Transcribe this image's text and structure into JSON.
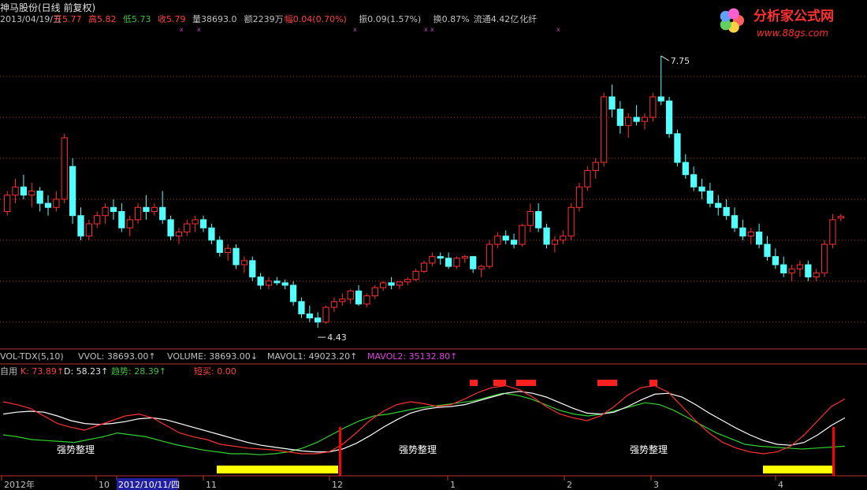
{
  "header": {
    "title": "神马股份(日线 前复权)",
    "date": "2013/04/19/五",
    "fields": [
      {
        "label": "开",
        "value": "5.77",
        "color": "#ff4040"
      },
      {
        "label": "高",
        "value": "5.82",
        "color": "#ff4040"
      },
      {
        "label": "低",
        "value": "5.73",
        "color": "#40c040"
      },
      {
        "label": "收",
        "value": "5.79",
        "color": "#ff4040"
      },
      {
        "label": "量",
        "value": "38693.0",
        "color": "#c0c0c0"
      },
      {
        "label": "额",
        "value": "2239万",
        "color": "#c0c0c0"
      },
      {
        "label": "幅",
        "value": "0.04(0.70%)",
        "color": "#ff4040"
      },
      {
        "label": "振",
        "value": "0.09(1.57%)",
        "color": "#c0c0c0"
      },
      {
        "label": "换",
        "value": "0.87%",
        "color": "#c0c0c0"
      },
      {
        "label": "流通",
        "value": "4.42亿",
        "color": "#c0c0c0"
      },
      {
        "label": "",
        "value": "化纤",
        "color": "#c0c0c0"
      }
    ]
  },
  "logo": {
    "name": "分析家公式网",
    "url": "www.88gs.com"
  },
  "volume_bar": {
    "items": [
      {
        "text": "VOL-TDX(5,10)",
        "color": "#c0c0c0"
      },
      {
        "text": "VVOL: 38693.00↑",
        "color": "#c0c0c0"
      },
      {
        "text": "VOLUME: 38693.00↓",
        "color": "#c0c0c0"
      },
      {
        "text": "MAVOL1: 49023.20↑",
        "color": "#c0c0c0"
      },
      {
        "text": "MAVOL2: 35132.80↑",
        "color": "#e040e0"
      }
    ]
  },
  "indicator_bar": {
    "items": [
      {
        "text": "自用",
        "color": "#c0c0c0"
      },
      {
        "text": "K: 73.89↑",
        "color": "#ff4040"
      },
      {
        "text": "D: 58.23↑",
        "color": "#e0e0e0"
      },
      {
        "text": "趋势: 28.39↑",
        "color": "#40c040"
      },
      {
        "text": "短买: 0.00",
        "color": "#ff4040"
      }
    ]
  },
  "annotations": {
    "high": "7.75",
    "low": "4.43",
    "zone_label": "强势整理"
  },
  "colors": {
    "up": "#ff3030",
    "down": "#54ffff",
    "k": "#ff3030",
    "d": "#ffffff",
    "trend": "#30d030",
    "zone": "#ffff00",
    "signal": "#ff0000",
    "axis": "#c03030"
  },
  "chart_data": {
    "type": "candlestick",
    "title": "神马股份(日线 前复权)",
    "price_range": [
      4.2,
      8.0
    ],
    "x_axis_labels": [
      "2012年",
      "10",
      "2012/10/11/四",
      "11",
      "12",
      "1",
      "2",
      "3",
      "4"
    ],
    "ohlc_estimated_daily": [
      [
        5.85,
        6.1,
        5.8,
        6.05
      ],
      [
        6.05,
        6.25,
        5.95,
        6.15
      ],
      [
        6.15,
        6.3,
        6.0,
        6.05
      ],
      [
        6.05,
        6.2,
        5.9,
        6.1
      ],
      [
        6.1,
        6.15,
        5.85,
        5.95
      ],
      [
        5.95,
        6.05,
        5.8,
        5.9
      ],
      [
        5.9,
        6.1,
        5.85,
        6.0
      ],
      [
        6.0,
        6.8,
        5.95,
        6.75
      ],
      [
        6.4,
        6.5,
        5.7,
        5.8
      ],
      [
        5.8,
        5.9,
        5.5,
        5.55
      ],
      [
        5.55,
        5.75,
        5.5,
        5.7
      ],
      [
        5.7,
        5.85,
        5.65,
        5.8
      ],
      [
        5.8,
        5.95,
        5.7,
        5.9
      ],
      [
        5.9,
        6.0,
        5.75,
        5.85
      ],
      [
        5.85,
        5.95,
        5.6,
        5.65
      ],
      [
        5.65,
        5.8,
        5.55,
        5.75
      ],
      [
        5.75,
        5.95,
        5.7,
        5.9
      ],
      [
        5.9,
        6.05,
        5.75,
        5.85
      ],
      [
        5.85,
        5.95,
        5.8,
        5.9
      ],
      [
        5.9,
        6.1,
        5.7,
        5.75
      ],
      [
        5.75,
        5.8,
        5.5,
        5.55
      ],
      [
        5.55,
        5.65,
        5.45,
        5.6
      ],
      [
        5.6,
        5.75,
        5.55,
        5.7
      ],
      [
        5.7,
        5.8,
        5.6,
        5.75
      ],
      [
        5.75,
        5.8,
        5.6,
        5.65
      ],
      [
        5.65,
        5.7,
        5.45,
        5.5
      ],
      [
        5.5,
        5.55,
        5.3,
        5.35
      ],
      [
        5.35,
        5.45,
        5.25,
        5.4
      ],
      [
        5.4,
        5.45,
        5.15,
        5.2
      ],
      [
        5.2,
        5.3,
        5.1,
        5.25
      ],
      [
        5.25,
        5.3,
        5.0,
        5.05
      ],
      [
        5.05,
        5.1,
        4.9,
        4.95
      ],
      [
        4.95,
        5.05,
        4.9,
        5.0
      ],
      [
        5.0,
        5.05,
        4.95,
        4.98
      ],
      [
        4.98,
        5.02,
        4.9,
        4.95
      ],
      [
        4.95,
        5.0,
        4.7,
        4.75
      ],
      [
        4.75,
        4.8,
        4.55,
        4.6
      ],
      [
        4.6,
        4.7,
        4.5,
        4.55
      ],
      [
        4.55,
        4.62,
        4.43,
        4.5
      ],
      [
        4.5,
        4.7,
        4.48,
        4.68
      ],
      [
        4.68,
        4.8,
        4.62,
        4.75
      ],
      [
        4.75,
        4.85,
        4.7,
        4.78
      ],
      [
        4.78,
        4.9,
        4.72,
        4.88
      ],
      [
        4.88,
        4.95,
        4.7,
        4.72
      ],
      [
        4.72,
        4.85,
        4.68,
        4.82
      ],
      [
        4.82,
        4.95,
        4.78,
        4.92
      ],
      [
        4.92,
        5.0,
        4.88,
        4.98
      ],
      [
        4.98,
        5.05,
        4.9,
        4.95
      ],
      [
        4.95,
        5.0,
        4.9,
        4.99
      ],
      [
        4.99,
        5.05,
        4.95,
        5.02
      ],
      [
        5.02,
        5.15,
        5.0,
        5.12
      ],
      [
        5.12,
        5.25,
        5.1,
        5.22
      ],
      [
        5.22,
        5.35,
        5.18,
        5.3
      ],
      [
        5.3,
        5.35,
        5.2,
        5.28
      ],
      [
        5.28,
        5.35,
        5.15,
        5.18
      ],
      [
        5.18,
        5.3,
        5.15,
        5.28
      ],
      [
        5.28,
        5.32,
        5.22,
        5.3
      ],
      [
        5.3,
        5.3,
        5.1,
        5.15
      ],
      [
        5.15,
        5.2,
        5.05,
        5.18
      ],
      [
        5.18,
        5.5,
        5.15,
        5.45
      ],
      [
        5.45,
        5.6,
        5.4,
        5.55
      ],
      [
        5.55,
        5.62,
        5.45,
        5.5
      ],
      [
        5.5,
        5.58,
        5.4,
        5.45
      ],
      [
        5.45,
        5.7,
        5.42,
        5.68
      ],
      [
        5.68,
        5.95,
        5.6,
        5.85
      ],
      [
        5.85,
        5.95,
        5.6,
        5.65
      ],
      [
        5.65,
        5.7,
        5.4,
        5.45
      ],
      [
        5.45,
        5.55,
        5.35,
        5.5
      ],
      [
        5.5,
        5.62,
        5.45,
        5.55
      ],
      [
        5.55,
        5.95,
        5.5,
        5.9
      ],
      [
        5.9,
        6.2,
        5.85,
        6.15
      ],
      [
        6.15,
        6.4,
        6.1,
        6.35
      ],
      [
        6.35,
        6.5,
        6.25,
        6.45
      ],
      [
        6.45,
        7.3,
        6.4,
        7.25
      ],
      [
        7.25,
        7.4,
        7.0,
        7.1
      ],
      [
        7.1,
        7.2,
        6.8,
        6.9
      ],
      [
        6.9,
        7.05,
        6.75,
        7.0
      ],
      [
        7.0,
        7.15,
        6.9,
        6.95
      ],
      [
        6.95,
        7.05,
        6.85,
        7.0
      ],
      [
        7.0,
        7.3,
        6.95,
        7.25
      ],
      [
        7.25,
        7.75,
        7.15,
        7.2
      ],
      [
        7.2,
        7.25,
        6.75,
        6.8
      ],
      [
        6.8,
        6.85,
        6.4,
        6.45
      ],
      [
        6.45,
        6.55,
        6.25,
        6.3
      ],
      [
        6.3,
        6.4,
        6.1,
        6.15
      ],
      [
        6.15,
        6.25,
        6.0,
        6.1
      ],
      [
        6.1,
        6.2,
        5.9,
        5.95
      ],
      [
        5.95,
        6.05,
        5.8,
        5.9
      ],
      [
        5.9,
        6.0,
        5.75,
        5.8
      ],
      [
        5.8,
        5.9,
        5.6,
        5.65
      ],
      [
        5.65,
        5.75,
        5.5,
        5.55
      ],
      [
        5.55,
        5.65,
        5.45,
        5.6
      ],
      [
        5.6,
        5.7,
        5.4,
        5.45
      ],
      [
        5.45,
        5.55,
        5.25,
        5.3
      ],
      [
        5.3,
        5.4,
        5.15,
        5.2
      ],
      [
        5.2,
        5.3,
        5.05,
        5.1
      ],
      [
        5.1,
        5.2,
        5.0,
        5.15
      ],
      [
        5.15,
        5.25,
        5.05,
        5.2
      ],
      [
        5.2,
        5.25,
        5.0,
        5.05
      ],
      [
        5.05,
        5.15,
        5.0,
        5.1
      ],
      [
        5.1,
        5.5,
        5.05,
        5.45
      ],
      [
        5.45,
        5.82,
        5.4,
        5.75
      ],
      [
        5.77,
        5.82,
        5.73,
        5.79
      ]
    ],
    "kd_estimated": {
      "K": [
        75,
        72,
        68,
        60,
        52,
        48,
        45,
        50,
        55,
        60,
        62,
        58,
        50,
        42,
        38,
        35,
        30,
        28,
        26,
        25,
        24,
        22,
        20,
        20,
        22,
        30,
        42,
        55,
        65,
        72,
        75,
        73,
        70,
        72,
        78,
        85,
        90,
        92,
        88,
        80,
        70,
        62,
        58,
        55,
        60,
        70,
        82,
        90,
        92,
        85,
        70,
        55,
        42,
        32,
        26,
        22,
        20,
        22,
        28,
        40,
        55,
        70,
        78
      ],
      "D": [
        62,
        64,
        65,
        64,
        60,
        55,
        52,
        51,
        52,
        54,
        57,
        58,
        56,
        52,
        48,
        44,
        40,
        36,
        32,
        29,
        27,
        25,
        23,
        22,
        22,
        25,
        31,
        39,
        48,
        56,
        63,
        67,
        69,
        70,
        72,
        76,
        80,
        84,
        86,
        84,
        80,
        74,
        68,
        63,
        62,
        64,
        70,
        77,
        83,
        84,
        80,
        72,
        63,
        55,
        47,
        40,
        34,
        30,
        29,
        32,
        40,
        50,
        58
      ],
      "trend": [
        40,
        38,
        35,
        34,
        33,
        32,
        35,
        38,
        42,
        40,
        38,
        34,
        30,
        27,
        24,
        22,
        20,
        20,
        19,
        20,
        22,
        26,
        32,
        40,
        48,
        55,
        60,
        62,
        65,
        68,
        70,
        72,
        74,
        76,
        80,
        84,
        82,
        78,
        72,
        66,
        62,
        60,
        62,
        66,
        70,
        74,
        72,
        66,
        58,
        50,
        42,
        36,
        30,
        28,
        27,
        26,
        25,
        26,
        27,
        28
      ]
    },
    "zones_yellow_pct": [
      [
        0.25,
        0.39
      ],
      [
        0.88,
        0.96
      ]
    ]
  }
}
